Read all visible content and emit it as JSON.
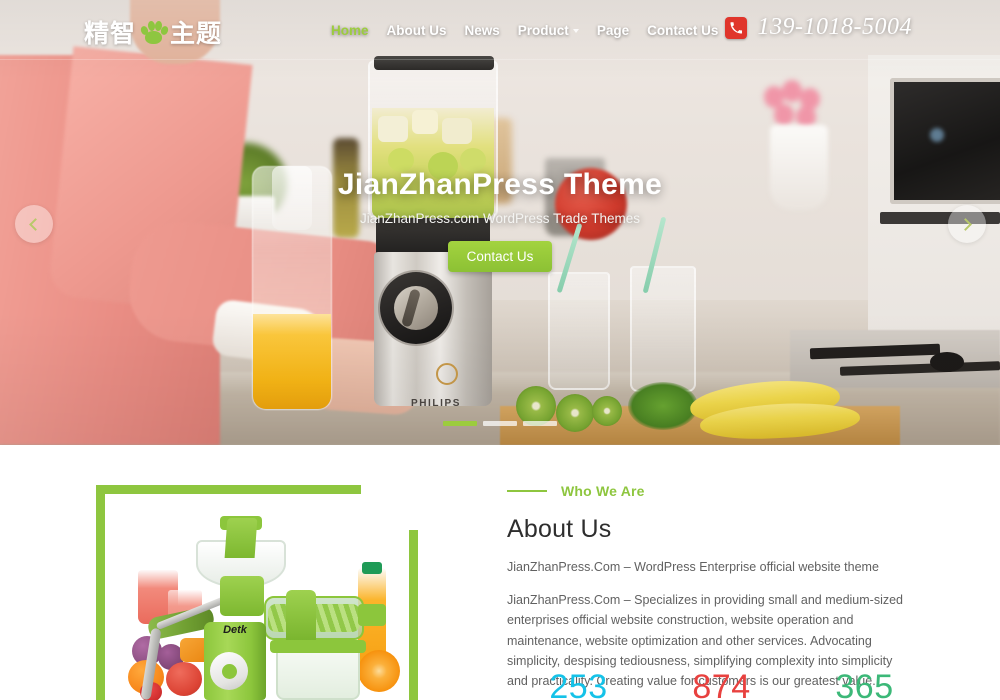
{
  "header": {
    "logo": {
      "text_before": "精智",
      "icon": "paw-print-icon",
      "text_after": "主题"
    },
    "nav": [
      {
        "label": "Home",
        "active": true,
        "dropdown": false
      },
      {
        "label": "About Us",
        "active": false,
        "dropdown": false
      },
      {
        "label": "News",
        "active": false,
        "dropdown": false
      },
      {
        "label": "Product",
        "active": false,
        "dropdown": true
      },
      {
        "label": "Page",
        "active": false,
        "dropdown": false
      },
      {
        "label": "Contact Us",
        "active": false,
        "dropdown": false
      }
    ],
    "phone": {
      "icon": "phone-icon",
      "number": "139-1018-5004",
      "badge_color": "#e0352b"
    }
  },
  "hero": {
    "title": "JianZhanPress Theme",
    "subtitle": "JianZhanPress.com WordPress Trade Themes",
    "button_label": "Contact Us",
    "button_color": "#8cc134",
    "prev_icon": "chevron-left-icon",
    "next_icon": "chevron-right-icon",
    "slides": [
      {
        "active": true
      },
      {
        "active": false
      },
      {
        "active": false
      }
    ],
    "image_alt": "Woman in pink sweater using a Philips blender in a bright kitchen with fruit, glasses and a carafe of orange juice"
  },
  "about": {
    "eyebrow": "Who We Are",
    "heading": "About Us",
    "lead": "JianZhanPress.Com – WordPress Enterprise official website theme",
    "body": "JianZhanPress.Com – Specializes in providing small and medium-sized enterprises official website construction, website operation and maintenance, website optimization and other services. Advocating simplicity, despising tediousness, simplifying complexity into simplicity and practicality. Creating value for customers is our greatest value.",
    "image_alt": "Green manual juicer surrounded by fresh fruit, vegetables and juice bottles",
    "frame_color": "#8ec63f",
    "accent_color": "#8ec63f",
    "stats": [
      {
        "value": "253",
        "color": "#15c2e8"
      },
      {
        "value": "874",
        "color": "#e8413f"
      },
      {
        "value": "365",
        "color": "#3cb878"
      }
    ]
  }
}
